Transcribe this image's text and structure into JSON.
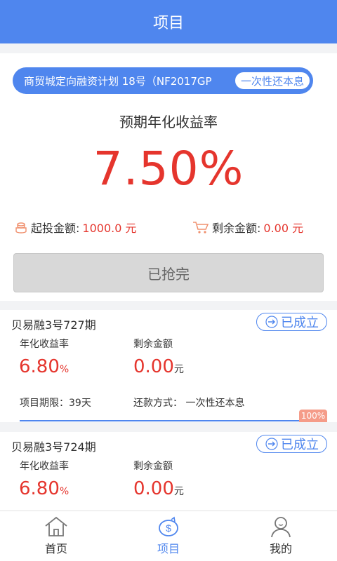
{
  "header": {
    "title": "项目"
  },
  "featured": {
    "name": "商贸城定向融资计划 18号（NF2017GP",
    "repay_badge": "一次性还本息",
    "rate_caption": "预期年化收益率",
    "rate_value": "7.50%",
    "min_label": "起投金额:",
    "min_value": "1000.0 元",
    "remain_label": "剩余金额:",
    "remain_value": "0.00 元",
    "sold_out_label": "已抢完"
  },
  "cards": [
    {
      "name": "贝易融3号727期",
      "status": "已成立",
      "rate_label": "年化收益率",
      "remain_label": "剩余金额",
      "rate_value": "6.80",
      "rate_unit": "%",
      "remain_value": "0.00",
      "remain_unit": "元",
      "term_text": "项目期限：39天",
      "repay_text": "还款方式： 一次性还本息",
      "progress_label": "100%",
      "progress": 1.0
    },
    {
      "name": "贝易融3号724期",
      "status": "已成立",
      "rate_label": "年化收益率",
      "remain_label": "剩余金额",
      "rate_value": "6.80",
      "rate_unit": "%",
      "remain_value": "0.00",
      "remain_unit": "元"
    }
  ],
  "tabbar": {
    "items": [
      {
        "label": "首页",
        "icon": "home-icon"
      },
      {
        "label": "项目",
        "icon": "piggy-bank-icon",
        "active": true
      },
      {
        "label": "我的",
        "icon": "user-icon"
      }
    ]
  },
  "colors": {
    "primary": "#4f86ee",
    "accent_red": "#e5352d",
    "progress_tag": "#f59c89"
  }
}
